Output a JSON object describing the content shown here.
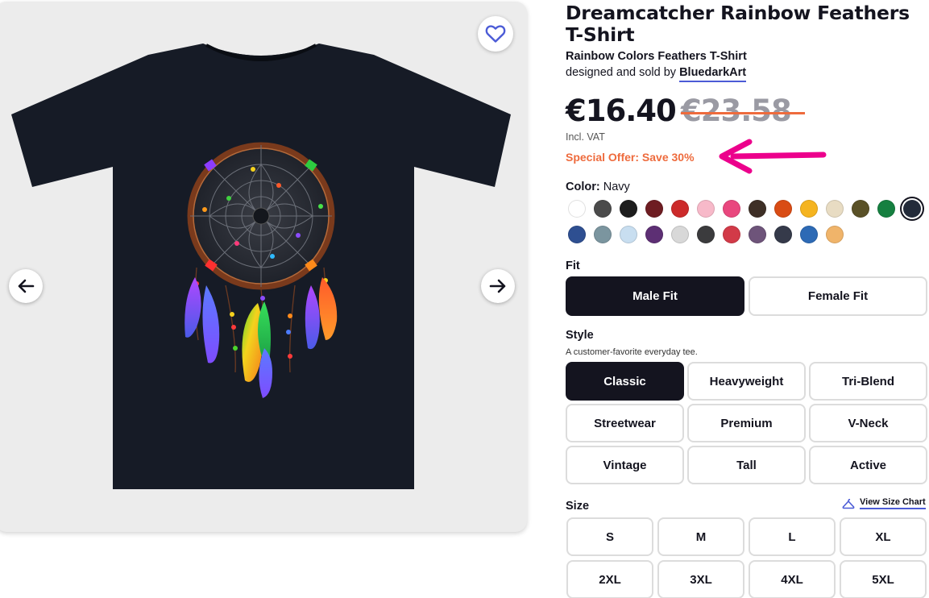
{
  "product": {
    "title": "Dreamcatcher Rainbow Feathers T-Shirt",
    "subtitle": "Rainbow Colors Feathers T-Shirt",
    "designer_prefix": "designed and sold by ",
    "designer_name": "BluedarkArt"
  },
  "pricing": {
    "price": "€16.40",
    "old_price": "€23.58",
    "vat_note": "Incl. VAT",
    "offer": "Special Offer: Save 30%"
  },
  "color": {
    "label": "Color:",
    "selected": "Navy",
    "swatches": [
      "#ffffff",
      "#4b4b4b",
      "#1d1d1d",
      "#6e1d22",
      "#cc2a2a",
      "#f7b9c9",
      "#e9477e",
      "#3e2f26",
      "#d94c14",
      "#f5b41f",
      "#e8dcc3",
      "#5a5127",
      "#168040",
      "#232b3a",
      "#2e4f91",
      "#7b959f",
      "#c8def0",
      "#5d2f74",
      "#d8d8d8",
      "#3b3b3d",
      "#d23a48",
      "#6e547a",
      "#353a4a",
      "#2d6ab5",
      "#f0b46a"
    ],
    "selected_index": 13
  },
  "fit": {
    "label": "Fit",
    "options": [
      "Male Fit",
      "Female Fit"
    ],
    "active_index": 0
  },
  "style": {
    "label": "Style",
    "description": "A customer-favorite everyday tee.",
    "options": [
      "Classic",
      "Heavyweight",
      "Tri-Blend",
      "Streetwear",
      "Premium",
      "V-Neck",
      "Vintage",
      "Tall",
      "Active"
    ],
    "active_index": 0
  },
  "size": {
    "label": "Size",
    "chart_link": "View Size Chart",
    "options": [
      "S",
      "M",
      "L",
      "XL",
      "2XL",
      "3XL",
      "4XL",
      "5XL"
    ]
  },
  "icons": {
    "favorite": "heart-icon",
    "prev": "arrow-left-icon",
    "next": "arrow-right-icon",
    "size_chart": "hanger-icon"
  },
  "colors": {
    "accent": "#4b5bd6",
    "offer": "#ee6b3d",
    "strike": "#ee6b3d",
    "annotation": "#ec008c",
    "dark": "#14141f",
    "shirt": "#161b26"
  }
}
